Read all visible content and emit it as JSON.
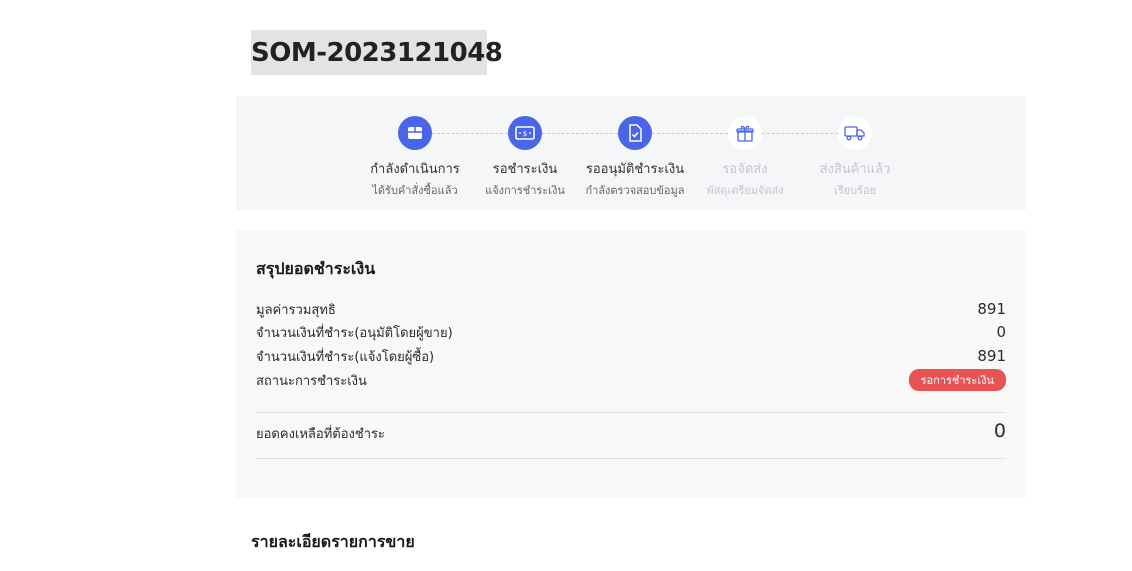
{
  "order": {
    "id": "SOM-2023121048"
  },
  "steps": [
    {
      "title": "กำลังดำเนินการ",
      "subtitle": "ได้รับคำสั่งซื้อแล้ว",
      "icon": "box-icon",
      "state": "active"
    },
    {
      "title": "รอชำระเงิน",
      "subtitle": "แจ้งการชำระเงิน",
      "icon": "cash-icon",
      "state": "active"
    },
    {
      "title": "รออนุมัติชำระเงิน",
      "subtitle": "กำลังตรวจสอบข้อมูล",
      "icon": "document-check-icon",
      "state": "active"
    },
    {
      "title": "รอจัดส่ง",
      "subtitle": "พัสดุเตรียมจัดส่ง",
      "icon": "gift-box-icon",
      "state": "inactive"
    },
    {
      "title": "ส่งสินค้าแล้ว",
      "subtitle": "เรียบร้อย",
      "icon": "truck-icon",
      "state": "inactive"
    }
  ],
  "summary": {
    "title": "สรุปยอดชำระเงิน",
    "rows": [
      {
        "label": "มูลค่ารวมสุทธิ",
        "value": "891"
      },
      {
        "label": "จำนวนเงินที่ชำระ(อนุมัติโดยผู้ขาย)",
        "value": "0"
      },
      {
        "label": "จำนวนเงินที่ชำระ(แจ้งโดยผู้ซื้อ)",
        "value": "891"
      }
    ],
    "status_label": "สถานะการชำระเงิน",
    "status_badge": "รอการชำระเงิน",
    "balance_label": "ยอดคงเหลือที่ต้องชำระ",
    "balance_value": "0"
  },
  "details": {
    "title": "รายละเอียดรายการขาย"
  },
  "colors": {
    "accent": "#4a66e8",
    "badge": "#e85454"
  }
}
